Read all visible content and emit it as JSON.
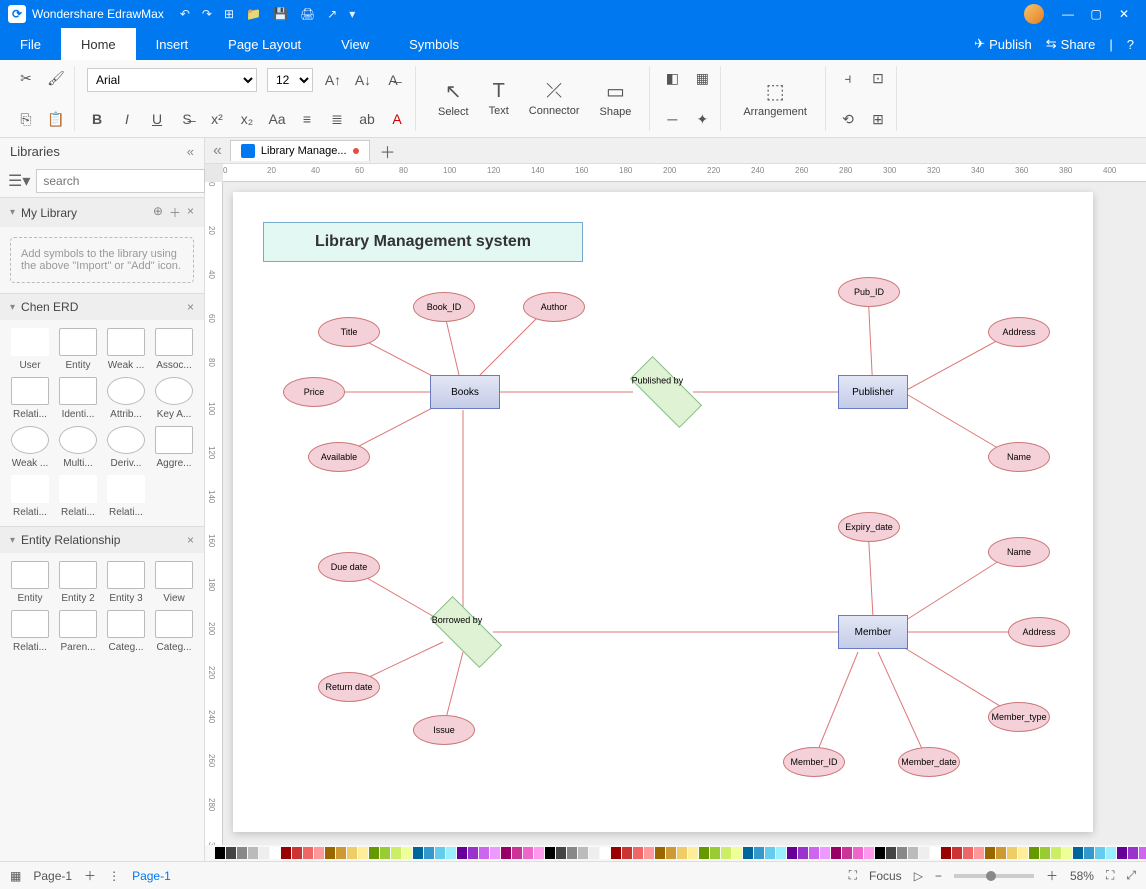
{
  "app": {
    "title": "Wondershare EdrawMax"
  },
  "menu": {
    "tabs": [
      "File",
      "Home",
      "Insert",
      "Page Layout",
      "View",
      "Symbols"
    ],
    "active": 1,
    "publish": "Publish",
    "share": "Share"
  },
  "ribbon": {
    "font": "Arial",
    "size": "12",
    "select": "Select",
    "text": "Text",
    "connector": "Connector",
    "shape": "Shape",
    "arrangement": "Arrangement"
  },
  "libraries": {
    "title": "Libraries",
    "search_ph": "search",
    "mylib": "My Library",
    "hint": "Add symbols to the library using the above \"Import\" or \"Add\" icon.",
    "chen": "Chen ERD",
    "chen_items": [
      "User",
      "Entity",
      "Weak ...",
      "Assoc...",
      "Relati...",
      "Identi...",
      "Attrib...",
      "Key A...",
      "Weak ...",
      "Multi...",
      "Deriv...",
      "Aggre...",
      "Relati...",
      "Relati...",
      "Relati..."
    ],
    "er": "Entity Relationship",
    "er_items": [
      "Entity",
      "Entity 2",
      "Entity 3",
      "View",
      "Relati...",
      "Paren...",
      "Categ...",
      "Categ..."
    ]
  },
  "doc": {
    "tab": "Library Manage...",
    "page": "Page-1"
  },
  "diagram": {
    "title": "Library Management system",
    "entities": {
      "books": "Books",
      "publisher": "Publisher",
      "member": "Member"
    },
    "rels": {
      "published": "Published by",
      "borrowed": "Borrowed by"
    },
    "attrs": {
      "title": "Title",
      "bookid": "Book_ID",
      "author": "Author",
      "price": "Price",
      "available": "Available",
      "pubid": "Pub_ID",
      "addr1": "Address",
      "name1": "Name",
      "duedate": "Due date",
      "returndate": "Return date",
      "issue": "Issue",
      "expiry": "Expiry_date",
      "name2": "Name",
      "addr2": "Address",
      "mtype": "Member_type",
      "mdate": "Member_date",
      "mid": "Member_ID"
    }
  },
  "status": {
    "focus": "Focus",
    "zoom": "58%",
    "page": "Page-1"
  }
}
